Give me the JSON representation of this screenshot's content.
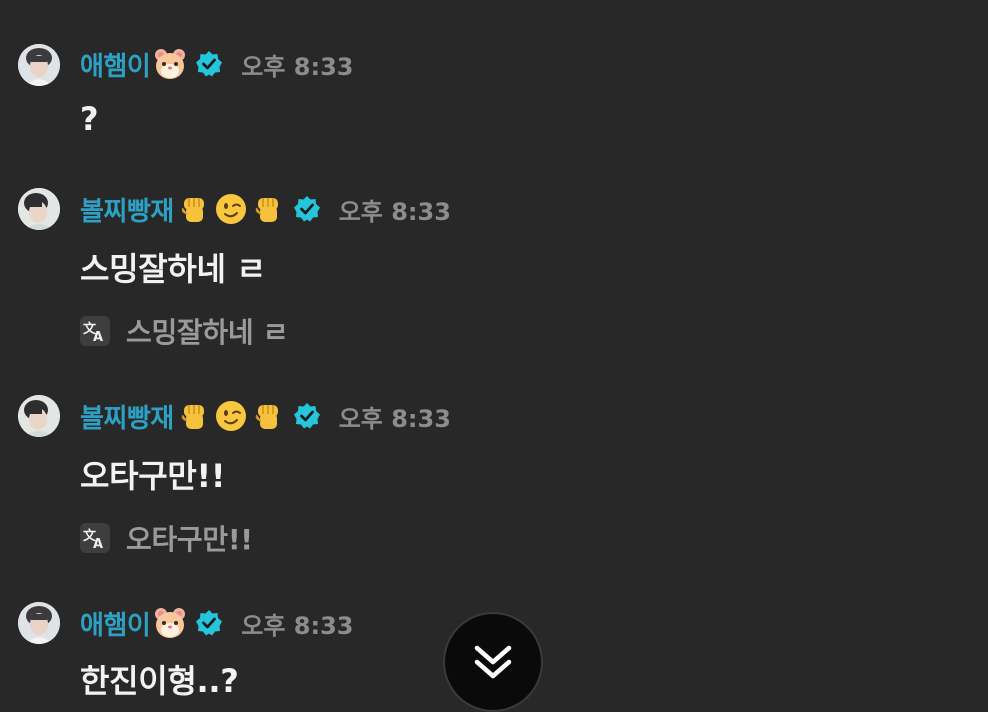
{
  "messages": [
    {
      "author": "애햄이",
      "author_emojis": [
        "hamster-emoji"
      ],
      "verified": true,
      "time": "오후 8:33",
      "text": "?",
      "translation": null
    },
    {
      "author": "볼찌빵재",
      "author_emojis": [
        "raised-fist-emoji",
        "winking-face-emoji",
        "raised-fist-emoji"
      ],
      "verified": true,
      "time": "오후 8:33",
      "text": "스밍잘하네 ㄹ",
      "translation": "스밍잘하네 ㄹ"
    },
    {
      "author": "볼찌빵재",
      "author_emojis": [
        "raised-fist-emoji",
        "winking-face-emoji",
        "raised-fist-emoji"
      ],
      "verified": true,
      "time": "오후 8:33",
      "text": "오타구만!!",
      "translation": "오타구만!!"
    },
    {
      "author": "애햄이",
      "author_emojis": [
        "hamster-emoji"
      ],
      "verified": true,
      "time": "오후 8:33",
      "text": "한진이형..?",
      "translation": null
    }
  ],
  "icons": {
    "verified": "verified-badge-icon",
    "translate": "translate-icon",
    "scroll_down": "double-chevron-down-icon"
  },
  "colors": {
    "background": "#282828",
    "author": "#2da0c3",
    "verified_badge": "#25c6dc",
    "time": "#8c8c8c",
    "message_text": "#f2f2f2",
    "translation_text": "#9a9a9a"
  }
}
